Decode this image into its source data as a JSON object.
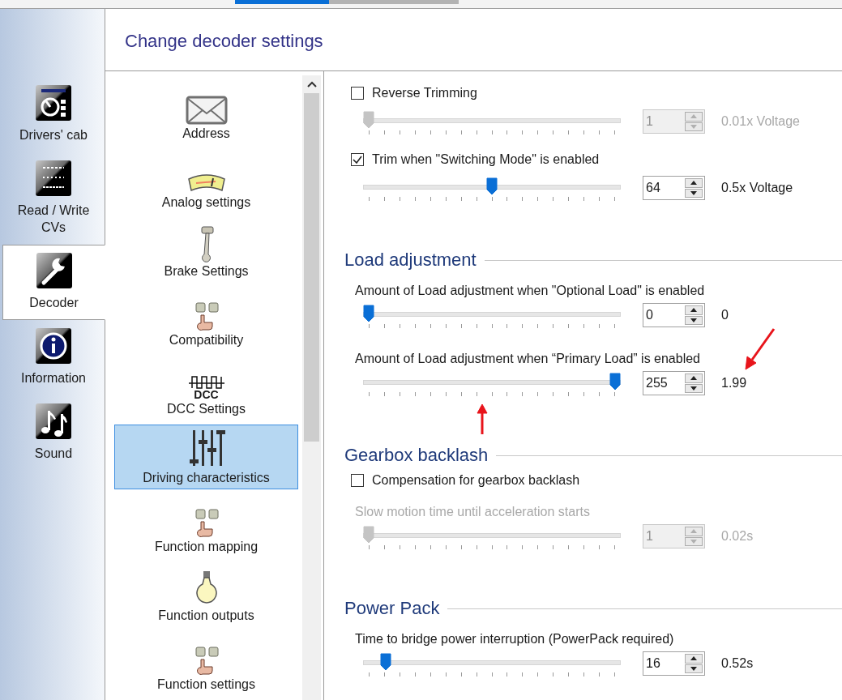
{
  "toolbar": {
    "progress": {
      "level": 0.42
    }
  },
  "nav": [
    {
      "kind": "cab",
      "label": "Drivers' cab",
      "selected": false
    },
    {
      "kind": "binary",
      "label": "Read / Write CVs",
      "selected": false
    },
    {
      "kind": "wrench",
      "label": "Decoder",
      "selected": true
    },
    {
      "kind": "info",
      "label": "Information",
      "selected": false
    },
    {
      "kind": "music",
      "label": "Sound",
      "selected": false
    }
  ],
  "header": {
    "title": "Change decoder settings"
  },
  "categories": [
    {
      "kind": "envelope",
      "label": "Address",
      "selected": false
    },
    {
      "kind": "gauge",
      "label": "Analog settings",
      "selected": false
    },
    {
      "kind": "brake",
      "label": "Brake Settings",
      "selected": false
    },
    {
      "kind": "keys",
      "label": "Compatibility",
      "selected": false
    },
    {
      "kind": "dcc",
      "icon_text": "DCC",
      "label": "DCC Settings",
      "selected": false
    },
    {
      "kind": "sliders",
      "label": "Driving characteristics",
      "selected": true
    },
    {
      "kind": "keys",
      "label": "Function mapping",
      "selected": false
    },
    {
      "kind": "bulb",
      "label": "Function outputs",
      "selected": false
    },
    {
      "kind": "keys",
      "label": "Function settings",
      "selected": false
    }
  ],
  "settings": [
    {
      "kind": "checkbox",
      "label": "Reverse Trimming",
      "checked": false
    },
    {
      "kind": "slider",
      "disabled": true,
      "level": 0,
      "value": "1",
      "reading": "0.01x Voltage"
    },
    {
      "kind": "checkbox",
      "label": "Trim when \"Switching Mode\" is enabled",
      "checked": true
    },
    {
      "kind": "slider",
      "disabled": false,
      "level": 0.5,
      "value": "64",
      "reading": "0.5x Voltage"
    },
    {
      "kind": "heading",
      "text": "Load adjustment"
    },
    {
      "kind": "label",
      "disabled": false,
      "text": "Amount of Load adjustment when \"Optional Load\" is enabled"
    },
    {
      "kind": "slider",
      "disabled": false,
      "level": 0,
      "value": "0",
      "reading": "0"
    },
    {
      "kind": "label",
      "disabled": false,
      "text": "Amount of Load adjustment when “Primary Load” is enabled"
    },
    {
      "kind": "slider",
      "disabled": false,
      "level": 1,
      "value": "255",
      "reading": "1.99"
    },
    {
      "kind": "heading",
      "text": "Gearbox backlash"
    },
    {
      "kind": "checkbox",
      "label": "Compensation for gearbox backlash",
      "checked": false
    },
    {
      "kind": "label",
      "disabled": true,
      "text": "Slow motion time until acceleration starts"
    },
    {
      "kind": "slider",
      "disabled": true,
      "level": 0,
      "value": "1",
      "reading": "0.02s"
    },
    {
      "kind": "heading",
      "text": "Power Pack"
    },
    {
      "kind": "label",
      "disabled": false,
      "text": "Time to bridge power interruption (PowerPack required)"
    },
    {
      "kind": "slider",
      "disabled": false,
      "level": 0.07,
      "value": "16",
      "reading": "0.52s"
    }
  ]
}
